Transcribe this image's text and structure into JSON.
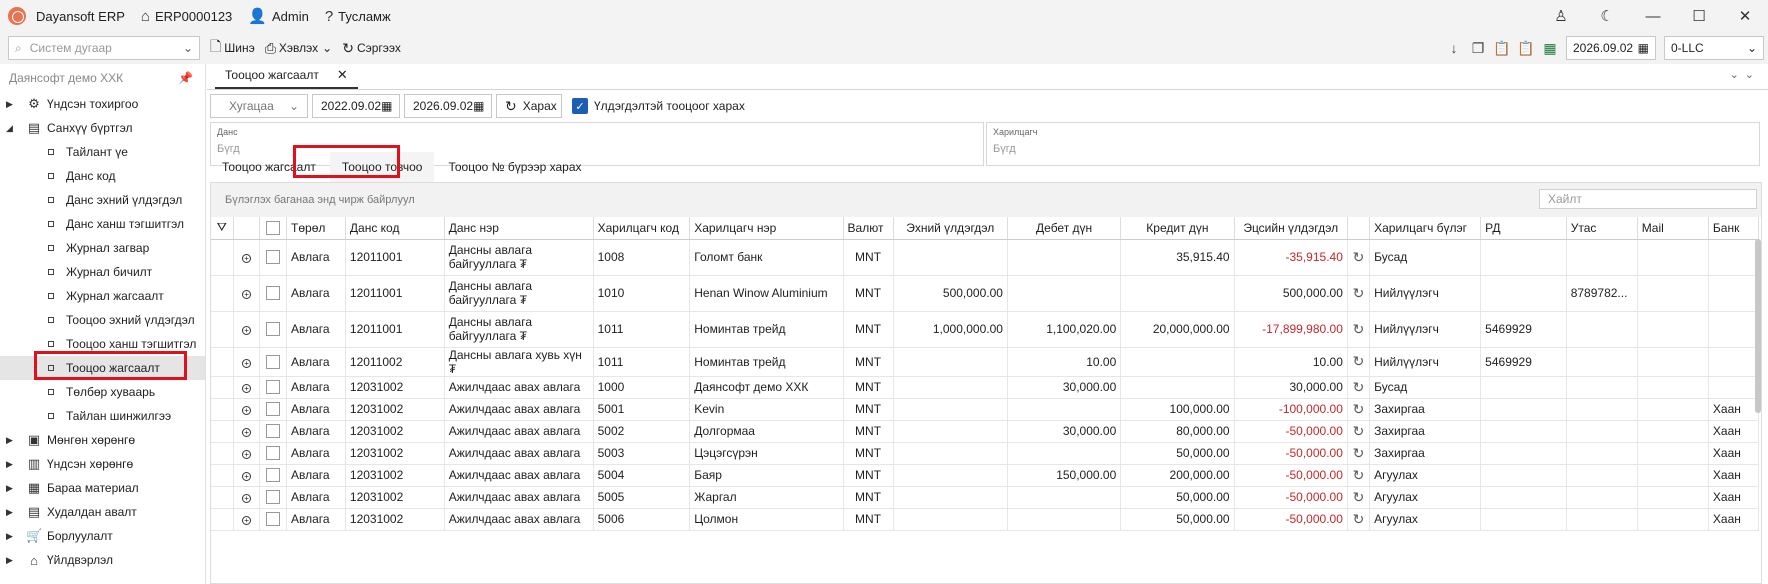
{
  "app": {
    "name": "Dayansoft ERP",
    "doc": "ERP0000123",
    "user": "Admin",
    "help": "Тусламж"
  },
  "toolbar": {
    "search_placeholder": "Систем дугаар",
    "new": "Шинэ",
    "print": "Хэвлэх",
    "refresh": "Сэргээх",
    "date": "2026.09.02",
    "company": "0-LLC"
  },
  "sidebar": {
    "title": "Даянсофт демо ХХК",
    "top": [
      {
        "label": "Үндсэн тохиргоо"
      },
      {
        "label": "Санхүү бүртгэл"
      }
    ],
    "sub": [
      {
        "label": "Тайлант үе"
      },
      {
        "label": "Данс код"
      },
      {
        "label": "Данс эхний үлдэгдэл"
      },
      {
        "label": "Данс ханш тэгшитгэл"
      },
      {
        "label": "Журнал загвар"
      },
      {
        "label": "Журнал бичилт"
      },
      {
        "label": "Журнал жагсаалт"
      },
      {
        "label": "Тооцоо эхний үлдэгдэл"
      },
      {
        "label": "Тооцоо ханш тэгшитгэл"
      },
      {
        "label": "Тооцоо жагсаалт"
      },
      {
        "label": "Төлбөр хуваарь"
      },
      {
        "label": "Тайлан шинжилгээ"
      }
    ],
    "bottom": [
      {
        "label": "Мөнгөн хөрөнгө"
      },
      {
        "label": "Үндсэн хөрөнгө"
      },
      {
        "label": "Бараа материал"
      },
      {
        "label": "Худалдан авалт"
      },
      {
        "label": "Борлуулалт"
      },
      {
        "label": "Үйлдвэрлэл"
      }
    ]
  },
  "doc_tab": "Тооцоо жагсаалт",
  "filter": {
    "period": "Хугацаа",
    "from": "2022.09.02",
    "to": "2026.09.02",
    "view": "Харах",
    "checkbox": "Үлдэгдэлтэй тооцоог харах"
  },
  "fields": {
    "account_label": "Данс",
    "account_ph": "Бүгд",
    "partner_label": "Харилцагч",
    "partner_ph": "Бүгд"
  },
  "subtabs": [
    "Тооцоо жагсаалт",
    "Тооцоо товчоо",
    "Тооцоо № бүрээр харах"
  ],
  "grid": {
    "group_hint": "Бүлэглэх баганаа энд чирж байрлуул",
    "search_placeholder": "Хайлт",
    "headers": [
      "Төрөл",
      "Данс код",
      "Данс нэр",
      "Харилцагч код",
      "Харилцагч нэр",
      "Валют",
      "Эхний үлдэгдэл",
      "Дебет дүн",
      "Кредит дүн",
      "Эцсийн үлдэгдэл",
      "Харилцагч бүлэг",
      "РД",
      "Утас",
      "Mail",
      "Банк"
    ],
    "rows": [
      [
        "Авлага",
        "12011001",
        "Дансны авлага байгууллага ₮",
        "1008",
        "Голомт банк",
        "MNT",
        "",
        "",
        "35,915.40",
        "-35,915.40",
        "Бусад",
        "",
        "",
        "",
        ""
      ],
      [
        "Авлага",
        "12011001",
        "Дансны авлага байгууллага ₮",
        "1010",
        "Henan Winow Aluminium",
        "MNT",
        "500,000.00",
        "",
        "",
        "500,000.00",
        "Нийлүүлэгч",
        "",
        "8789782...",
        "",
        ""
      ],
      [
        "Авлага",
        "12011001",
        "Дансны авлага байгууллага ₮",
        "1011",
        "Номинтав трейд",
        "MNT",
        "1,000,000.00",
        "1,100,020.00",
        "20,000,000.00",
        "-17,899,980.00",
        "Нийлүүлэгч",
        "5469929",
        "",
        "",
        ""
      ],
      [
        "Авлага",
        "12011002",
        "Дансны авлага хувь хүн ₮",
        "1011",
        "Номинтав трейд",
        "MNT",
        "",
        "10.00",
        "",
        "10.00",
        "Нийлүүлэгч",
        "5469929",
        "",
        "",
        ""
      ],
      [
        "Авлага",
        "12031002",
        "Ажилчдаас авах авлага",
        "1000",
        "Даянсофт демо ХХК",
        "MNT",
        "",
        "30,000.00",
        "",
        "30,000.00",
        "Бусад",
        "",
        "",
        "",
        ""
      ],
      [
        "Авлага",
        "12031002",
        "Ажилчдаас авах авлага",
        "5001",
        "Kevin",
        "MNT",
        "",
        "",
        "100,000.00",
        "-100,000.00",
        "Захиргаа",
        "",
        "",
        "",
        "Хаан"
      ],
      [
        "Авлага",
        "12031002",
        "Ажилчдаас авах авлага",
        "5002",
        "Долгормаа",
        "MNT",
        "",
        "30,000.00",
        "80,000.00",
        "-50,000.00",
        "Захиргаа",
        "",
        "",
        "",
        "Хаан"
      ],
      [
        "Авлага",
        "12031002",
        "Ажилчдаас авах авлага",
        "5003",
        "Цэцэгсүрэн",
        "MNT",
        "",
        "",
        "50,000.00",
        "-50,000.00",
        "Захиргаа",
        "",
        "",
        "",
        "Хаан"
      ],
      [
        "Авлага",
        "12031002",
        "Ажилчдаас авах авлага",
        "5004",
        "Баяр",
        "MNT",
        "",
        "150,000.00",
        "200,000.00",
        "-50,000.00",
        "Агуулах",
        "",
        "",
        "",
        "Хаан"
      ],
      [
        "Авлага",
        "12031002",
        "Ажилчдаас авах авлага",
        "5005",
        "Жаргал",
        "MNT",
        "",
        "",
        "50,000.00",
        "-50,000.00",
        "Агуулах",
        "",
        "",
        "",
        "Хаан"
      ],
      [
        "Авлага",
        "12031002",
        "Ажилчдаас авах авлага",
        "5006",
        "Цолмон",
        "MNT",
        "",
        "",
        "50,000.00",
        "-50,000.00",
        "Агуулах",
        "",
        "",
        "",
        "Хаан"
      ]
    ]
  }
}
